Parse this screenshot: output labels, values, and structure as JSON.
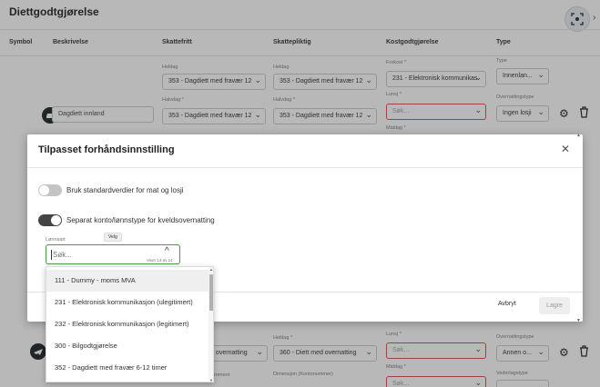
{
  "page": {
    "title": "Diettgodtgjørelse"
  },
  "table": {
    "headers": [
      "Symbol",
      "Beskrivelse",
      "Skattefritt",
      "Skattepliktig",
      "Kostgodtgjørelse",
      "Type"
    ]
  },
  "row1": {
    "skattefritt_label": "Heldag",
    "skattefritt_value": "353 - Dagdiett med fravær 12",
    "skattefritt_label2": "Halvdag *",
    "skattefritt_value2": "353 - Dagdiett med fravær 12",
    "skattepliktig_label": "Heldag",
    "skattepliktig_value": "353 - Dagdiett med fravær 12",
    "skattepliktig_label2": "Halvdag *",
    "skattepliktig_value2": "353 - Dagdiett med fravær 12",
    "kost_label": "Frokost *",
    "kost_value": "231 - Elektronisk kommunikas",
    "kost_label2": "Lunsj *",
    "kost_placeholder": "Søk...",
    "kost_label3": "Middag *",
    "type_label": "Type",
    "type_value": "Innenlan...",
    "overnatting_label": "Overnattingstype",
    "overnatting_value": "Ingen losji",
    "description": "Dagdiett innland"
  },
  "row3": {
    "skattefritt_value": "overnatting",
    "skattefritt_label2": "rnment",
    "skattepliktig_label": "Heldag *",
    "skattepliktig_value": "360 - Diett med overnatting",
    "skattepliktig_label2": "Dimensjon (Kontonummer)",
    "kost_label": "Lunsj *",
    "kost_placeholder": "Søk...",
    "kost_label2": "Middag *",
    "kost_placeholder2": "Søk...",
    "overnatting_label": "Overnattingstype",
    "overnatting_value": "Annen o...",
    "vederlag_label": "Vederlagstype"
  },
  "modal": {
    "title": "Tilpasset forhåndsinnstilling",
    "toggle1_label": "Bruk standardverdier for mat og losji",
    "toggle1_on": false,
    "toggle2_label": "Separat konto/lønnstype for kveldsovernatting",
    "toggle2_on": true,
    "lonnsart_label": "Lønnsart",
    "tooltip": "Velg",
    "search_placeholder": "Søk...",
    "search_count": "Viser 14 av 14",
    "cancel_label": "Avbryt",
    "save_label": "Lagre"
  },
  "dropdown": {
    "items": [
      "111 - Dummy - moms MVA",
      "231 - Elektronisk kommunikasjon (ulegitimert)",
      "232 - Elektronisk kommunikasjon (legitimert)",
      "300 - Bilgodtgjørelse",
      "352 - Dagdiett med fravær 6-12 timer"
    ],
    "highlighted_index": 0
  },
  "colors": {
    "toggle_on": "#444444",
    "focus_border": "#4a9a4a",
    "error_border": "#e05c5c"
  }
}
